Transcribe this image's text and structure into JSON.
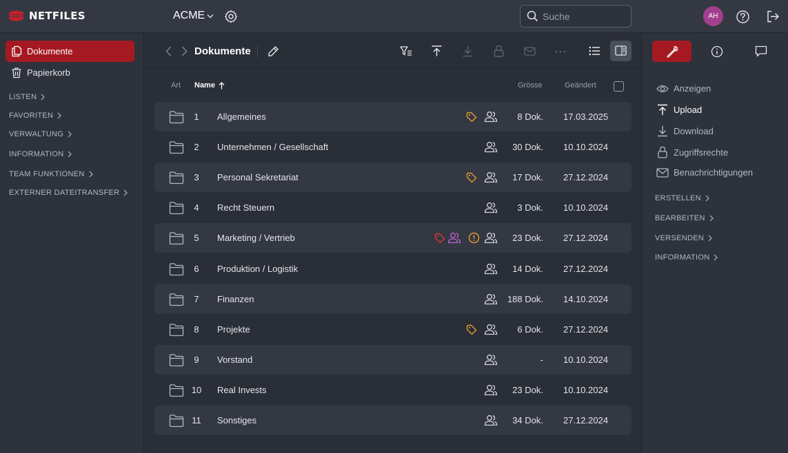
{
  "app": {
    "logo_text": "NETFILES",
    "workspace": "ACME"
  },
  "search": {
    "placeholder": "Suche"
  },
  "user": {
    "initials": "AH",
    "avatar_color": "#a2408f"
  },
  "colors": {
    "accent": "#a51a22",
    "tag": "#e79b2e",
    "alert_tag": "#d63a3a",
    "group_special": "#c064d6"
  },
  "sidebar": {
    "items": [
      {
        "label": "Dokumente",
        "icon": "documents-icon",
        "active": true
      },
      {
        "label": "Papierkorb",
        "icon": "trash-icon",
        "active": false
      }
    ],
    "sections": [
      {
        "label": "LISTEN"
      },
      {
        "label": "FAVORITEN"
      },
      {
        "label": "VERWALTUNG"
      },
      {
        "label": "INFORMATION"
      },
      {
        "label": "TEAM FUNKTIONEN"
      },
      {
        "label": "EXTERNER DATEITRANSFER"
      }
    ]
  },
  "toolbar": {
    "title": "Dokumente",
    "icons": [
      "back-icon",
      "forward-icon",
      "edit-icon",
      "filter-icon",
      "upload-icon",
      "download-icon",
      "lock-icon",
      "mail-icon",
      "more-icon",
      "list-view-icon",
      "side-panel-icon"
    ]
  },
  "table": {
    "headers": {
      "art": "Art",
      "name": "Name",
      "size": "Grösse",
      "changed": "Geändert"
    },
    "sort": {
      "column": "name",
      "direction": "ascending"
    },
    "rows": [
      {
        "num": "1",
        "name": "Allgemeines",
        "size": "8 Dok.",
        "date": "17.03.2025",
        "tag": true,
        "alert_tag": false,
        "special_group": false,
        "warning": false
      },
      {
        "num": "2",
        "name": "Unternehmen / Gesellschaft",
        "size": "30 Dok.",
        "date": "10.10.2024",
        "tag": false,
        "alert_tag": false,
        "special_group": false,
        "warning": false
      },
      {
        "num": "3",
        "name": "Personal Sekretariat",
        "size": "17 Dok.",
        "date": "27.12.2024",
        "tag": true,
        "alert_tag": false,
        "special_group": false,
        "warning": false
      },
      {
        "num": "4",
        "name": "Recht Steuern",
        "size": "3 Dok.",
        "date": "10.10.2024",
        "tag": false,
        "alert_tag": false,
        "special_group": false,
        "warning": false
      },
      {
        "num": "5",
        "name": "Marketing / Vertrieb",
        "size": "23 Dok.",
        "date": "27.12.2024",
        "tag": false,
        "alert_tag": true,
        "special_group": true,
        "warning": true
      },
      {
        "num": "6",
        "name": "Produktion / Logistik",
        "size": "14 Dok.",
        "date": "27.12.2024",
        "tag": false,
        "alert_tag": false,
        "special_group": false,
        "warning": false
      },
      {
        "num": "7",
        "name": "Finanzen",
        "size": "188 Dok.",
        "date": "14.10.2024",
        "tag": false,
        "alert_tag": false,
        "special_group": false,
        "warning": false
      },
      {
        "num": "8",
        "name": "Projekte",
        "size": "6 Dok.",
        "date": "27.12.2024",
        "tag": true,
        "alert_tag": false,
        "special_group": false,
        "warning": false
      },
      {
        "num": "9",
        "name": "Vorstand",
        "size": "-",
        "date": "10.10.2024",
        "tag": false,
        "alert_tag": false,
        "special_group": false,
        "warning": false
      },
      {
        "num": "10",
        "name": "Real Invests",
        "size": "23 Dok.",
        "date": "10.10.2024",
        "tag": false,
        "alert_tag": false,
        "special_group": false,
        "warning": false
      },
      {
        "num": "11",
        "name": "Sonstiges",
        "size": "34 Dok.",
        "date": "27.12.2024",
        "tag": false,
        "alert_tag": false,
        "special_group": false,
        "warning": false
      }
    ]
  },
  "right_panel": {
    "tabs": [
      {
        "icon": "wrench-icon",
        "active": true
      },
      {
        "icon": "info-icon",
        "active": false
      },
      {
        "icon": "comment-icon",
        "active": false
      }
    ],
    "actions": [
      {
        "label": "Anzeigen",
        "icon": "eye-icon",
        "enabled": false
      },
      {
        "label": "Upload",
        "icon": "upload-icon",
        "enabled": true
      },
      {
        "label": "Download",
        "icon": "download-icon",
        "enabled": false
      },
      {
        "label": "Zugriffsrechte",
        "icon": "lock-icon",
        "enabled": false
      },
      {
        "label": "Benachrichtigungen",
        "icon": "mail-icon",
        "enabled": false
      }
    ],
    "sections": [
      {
        "label": "ERSTELLEN"
      },
      {
        "label": "BEARBEITEN"
      },
      {
        "label": "VERSENDEN"
      },
      {
        "label": "INFORMATION"
      }
    ]
  }
}
